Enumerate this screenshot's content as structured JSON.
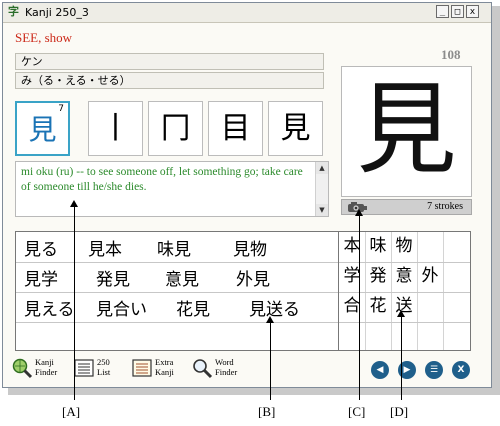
{
  "window": {
    "title": "Kanji 250_3"
  },
  "kanji": {
    "meaning": "SEE, show",
    "number": "108",
    "onyomi": "ケン",
    "kunyomi": "み（る・える・せる）",
    "character": "見",
    "stroke_count_badge": "7",
    "strokes_label": "7 strokes"
  },
  "stroke_steps": [
    "丨",
    "冂",
    "目",
    "見"
  ],
  "example_sentence": "mi oku (ru) -- to see someone off, let something go; take care of someone till he/she dies.",
  "words": [
    [
      "見る",
      "見本",
      "味見",
      "見物"
    ],
    [
      "見学",
      "発見",
      "意見",
      "外見"
    ],
    [
      "見える",
      "見合い",
      "花見",
      "見送る"
    ]
  ],
  "component_kanji": [
    [
      "本",
      "味",
      "物",
      ""
    ],
    [
      "学",
      "発",
      "意",
      "外"
    ],
    [
      "合",
      "花",
      "送",
      ""
    ]
  ],
  "toolbar": [
    {
      "line1": "Kanji",
      "line2": "Finder",
      "icon": "magnifier-globe-icon"
    },
    {
      "line1": "250",
      "line2": "List",
      "icon": "list-icon"
    },
    {
      "line1": "Extra",
      "line2": "Kanji",
      "icon": "extra-list-icon"
    },
    {
      "line1": "Word",
      "line2": "Finder",
      "icon": "magnifier-icon"
    }
  ],
  "nav_buttons": [
    "◀",
    "▶",
    "☰",
    "X"
  ],
  "callouts": [
    "[A]",
    "[B]",
    "[C]",
    "[D]"
  ],
  "colors": {
    "meaning": "#cc2a1a",
    "example": "#2b8a2b",
    "selected_border": "#3aa3c7",
    "nav": "#1f5f8b"
  }
}
